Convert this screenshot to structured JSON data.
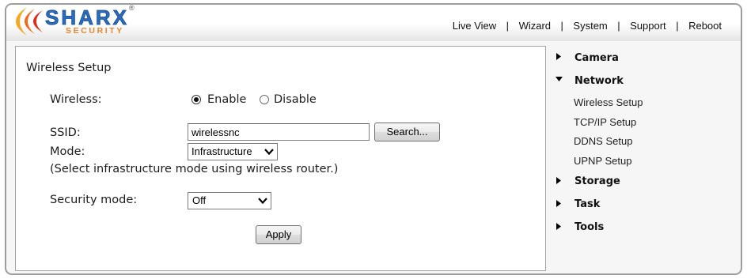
{
  "logo": {
    "brand": "SHARX",
    "tagline": "SECURITY",
    "registered_mark": "®",
    "colors": {
      "brand": "#2a6cbd",
      "tagline": "#e8862b",
      "swoosh_outer": "#f7a823",
      "swoosh_middle": "#ef6a1f",
      "swoosh_inner": "#d8301c"
    }
  },
  "top_nav": {
    "separator": "|",
    "items": [
      "Live View",
      "Wizard",
      "System",
      "Support",
      "Reboot"
    ]
  },
  "form": {
    "title": "Wireless Setup",
    "wireless": {
      "label": "Wireless:",
      "options": [
        {
          "label": "Enable",
          "checked": true
        },
        {
          "label": "Disable",
          "checked": false
        }
      ]
    },
    "ssid": {
      "label": "SSID:",
      "value": "wirelessnc",
      "search_button": "Search..."
    },
    "mode": {
      "label": "Mode:",
      "value": "Infrastructure",
      "hint": "(Select infrastructure mode using wireless router.)"
    },
    "security_mode": {
      "label": "Security mode:",
      "value": "Off"
    },
    "apply_button": "Apply"
  },
  "sidebar": {
    "sections": [
      {
        "label": "Camera",
        "expanded": false,
        "icon": "right-triangle-icon"
      },
      {
        "label": "Network",
        "expanded": true,
        "icon": "down-triangle-icon",
        "items": [
          "Wireless Setup",
          "TCP/IP Setup",
          "DDNS Setup",
          "UPNP Setup"
        ]
      },
      {
        "label": "Storage",
        "expanded": false,
        "icon": "right-triangle-icon"
      },
      {
        "label": "Task",
        "expanded": false,
        "icon": "right-triangle-icon"
      },
      {
        "label": "Tools",
        "expanded": false,
        "icon": "right-triangle-icon"
      }
    ]
  },
  "icons": {
    "select_arrow": "chevron-down-icon",
    "radio": "radio-button-icon"
  },
  "colors": {
    "frame_border": "#9d9d9d",
    "panel_border": "#a4a4a4",
    "panel_background": "#ffffff",
    "text": "#1c1c1c"
  }
}
